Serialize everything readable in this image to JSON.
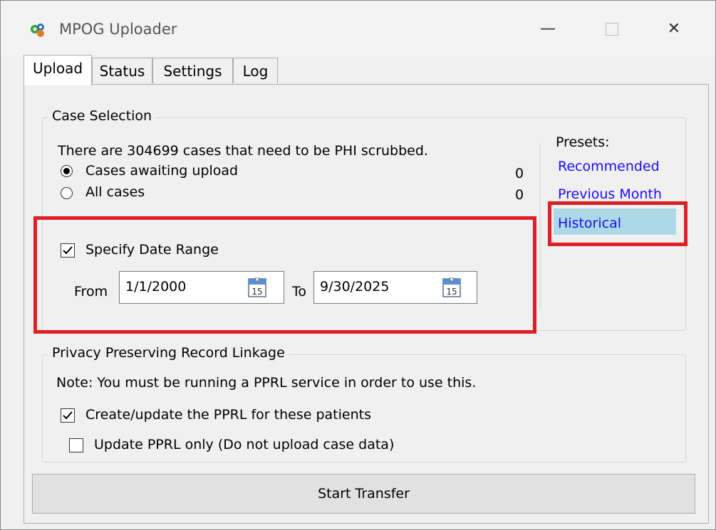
{
  "window": {
    "title": "MPOG Uploader",
    "minimize_glyph": "—",
    "close_glyph": "✕"
  },
  "tabs": [
    {
      "label": "Upload",
      "active": true
    },
    {
      "label": "Status",
      "active": false
    },
    {
      "label": "Settings",
      "active": false
    },
    {
      "label": "Log",
      "active": false
    }
  ],
  "case_selection": {
    "caption": "Case Selection",
    "summary": "There are 304699 cases that need to be PHI scrubbed.",
    "options": [
      {
        "label": "Cases awaiting upload",
        "count": "0",
        "selected": true
      },
      {
        "label": "All cases",
        "count": "0",
        "selected": false
      }
    ],
    "date_range": {
      "checkbox_label": "Specify Date Range",
      "checked": true,
      "from_label": "From",
      "from_value": "1/1/2000",
      "to_label": "To",
      "to_value": "9/30/2025",
      "calendar_day": "15"
    }
  },
  "presets": {
    "label": "Presets:",
    "items": [
      {
        "label": "Recommended",
        "selected": false
      },
      {
        "label": "Previous Month",
        "selected": false
      },
      {
        "label": "Historical",
        "selected": true
      }
    ]
  },
  "pprl": {
    "caption": "Privacy Preserving Record Linkage",
    "note": "Note: You must be running a PPRL service in order to use this.",
    "create_update_label": "Create/update the PPRL for these patients",
    "create_update_checked": true,
    "update_only_label": "Update PPRL only (Do not upload case data)",
    "update_only_checked": false
  },
  "start_button_label": "Start Transfer",
  "colors": {
    "link": "#1a0dff",
    "selection": "#add8e6",
    "annotation_red": "#e01e25"
  }
}
